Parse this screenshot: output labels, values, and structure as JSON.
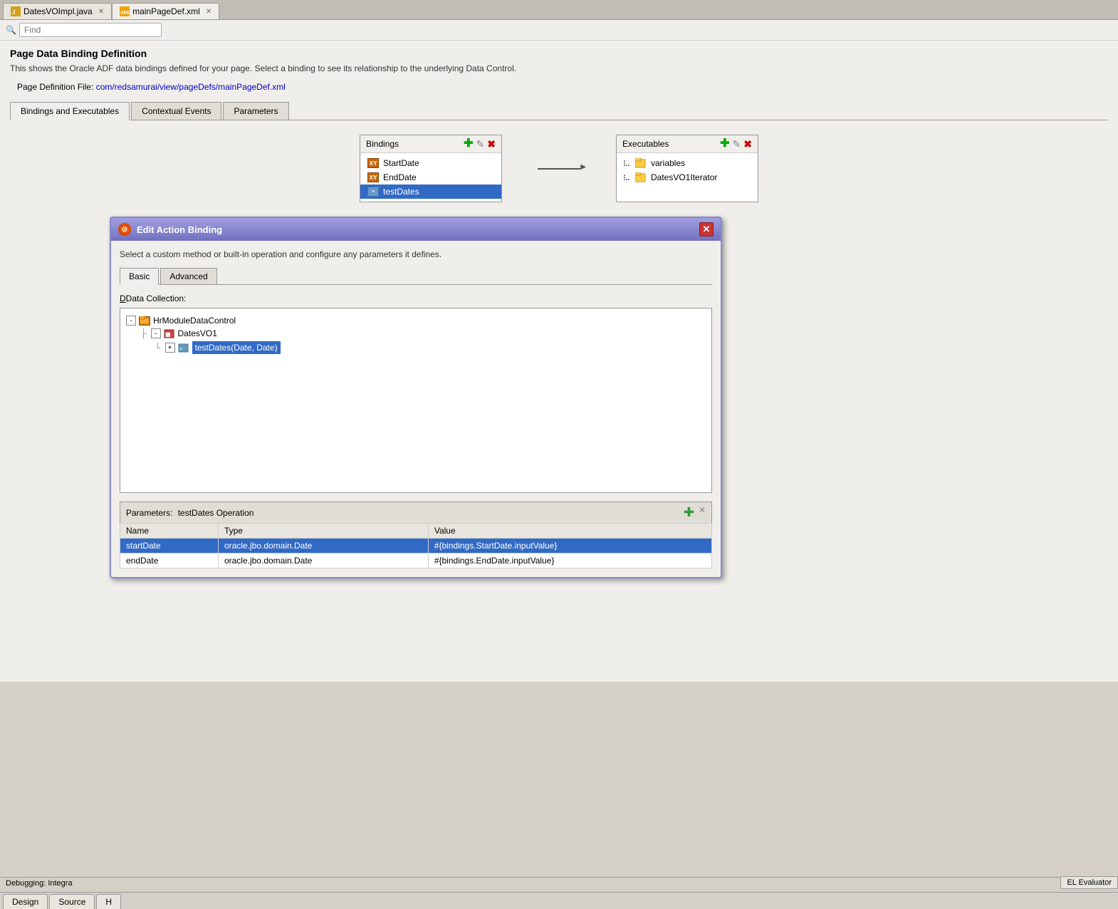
{
  "tabs": [
    {
      "id": "dates-vo",
      "label": "DatesVOImpl.java",
      "active": false,
      "icon": "java"
    },
    {
      "id": "main-page",
      "label": "mainPageDef.xml",
      "active": true,
      "icon": "xml"
    }
  ],
  "search": {
    "placeholder": "Find"
  },
  "page": {
    "title": "Page Data Binding Definition",
    "description": "This shows the Oracle ADF data bindings defined for your page. Select a binding to see its relationship to the underlying Data Control.",
    "def_label": "Page Definition File:",
    "def_link": "com/redsamurai/view/pageDefs/mainPageDef.xml"
  },
  "content_tabs": [
    {
      "label": "Bindings and Executables",
      "active": true
    },
    {
      "label": "Contextual Events",
      "active": false
    },
    {
      "label": "Parameters",
      "active": false
    }
  ],
  "bindings_panel": {
    "title": "Bindings",
    "items": [
      {
        "label": "StartDate",
        "type": "xy"
      },
      {
        "label": "EndDate",
        "type": "xy"
      },
      {
        "label": "testDates",
        "type": "grid",
        "selected": true
      }
    ]
  },
  "executables_panel": {
    "title": "Executables",
    "items": [
      {
        "label": "variables",
        "type": "folder"
      },
      {
        "label": "DatesVO1Iterator",
        "type": "folder"
      }
    ]
  },
  "modal": {
    "title": "Edit Action Binding",
    "description": "Select a custom method or built-in operation and configure any parameters it defines.",
    "tabs": [
      {
        "label": "Basic",
        "active": true
      },
      {
        "label": "Advanced",
        "active": false
      }
    ],
    "data_collection_label": "Data Collection:",
    "tree": {
      "root": "HrModuleDataControl",
      "child1": "DatesVO1",
      "child2": "testDates(Date, Date)"
    },
    "parameters": {
      "label": "Parameters:",
      "operation": "testDates Operation",
      "columns": [
        "Name",
        "Type",
        "Value"
      ],
      "rows": [
        {
          "name": "startDate",
          "type": "oracle.jbo.domain.Date",
          "value": "#{bindings.StartDate.inputValue}",
          "selected": true
        },
        {
          "name": "endDate",
          "type": "oracle.jbo.domain.Date",
          "value": "#{bindings.EndDate.inputValue}",
          "selected": false
        }
      ]
    }
  },
  "bottom_tabs": [
    {
      "label": "Design",
      "active": false
    },
    {
      "label": "Source",
      "active": false
    },
    {
      "label": "H",
      "active": false
    }
  ],
  "status_bar": {
    "message": "Debugging: Integra",
    "el_evaluator": "EL Evaluator"
  }
}
